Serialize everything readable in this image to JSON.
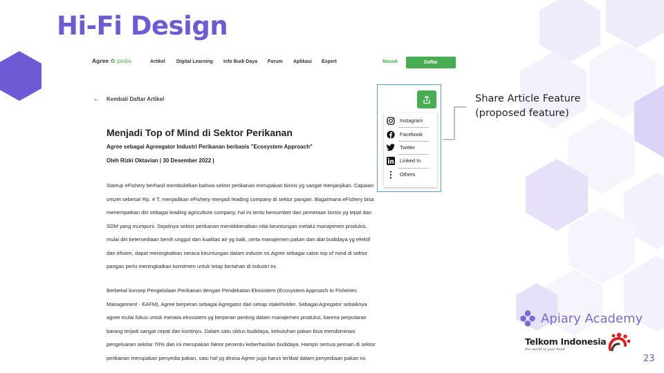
{
  "slide": {
    "title": "Hi-Fi Design",
    "annotation": [
      "Share Article Feature",
      "(proposed feature)"
    ],
    "brand": "Apiary Academy",
    "partner": {
      "name": "Telkom Indonesia",
      "tagline": "the world in your hand"
    },
    "page_number": "23",
    "colors": {
      "accent": "#6c5bd4",
      "hexagon_light": "#ece9fb",
      "hexagon_mid": "#d8d0f6"
    }
  },
  "site": {
    "logo": {
      "part1": "Agree",
      "part2": "pedia",
      "icon": "leaf-icon"
    },
    "nav": [
      "Artikel",
      "Digital Learning",
      "Info Budi Daya",
      "Forum",
      "Aplikasi",
      "Expert"
    ],
    "login": "Masuk",
    "register": "Daftar",
    "accent": "#48ad52"
  },
  "article": {
    "back_label": "Kembali Daftar Artikel",
    "title": "Menjadi Top of Mind di Sektor Perikanan",
    "subtitle": "Agree sebagai Agreegator Industri Perikanan berbasis \"Ecosystem Approach\"",
    "byline": "Oleh Rizki Oktavian | 30 Desember 2022 |",
    "para1": [
      "Startup eFishery berhasil membuktikan bahwa sektor perikanan merupakan bisnis yg sangat menjanjikan. Capaian",
      "omzet sebesar Rp. 4 T, menjadikan eFishery menjadi leading company di sektor pangan. Bagaimana eFishery bisa",
      "menempatkan diri sebagai leading agriculture company, hal ini tentu bersumber dari pemetaan bisnis yg tepat dan",
      "SDM yang mumpuni. Sejatinya sektor perikanan menitikberatkan nilai keuntungan melalui manajemen produksi,",
      "mulai diri ketersediaan benih unggul dan kualitas air yg baik, serta manajemen pakan dan alat budidaya yg efektif",
      "dan efisien, dapat meningkatkan neraca keuntungan dalam industri ini.Agree sebagai calon top of mind di sektor",
      "pangan perlu meningkatkan komitmen untuk tetap bertahan di industri ini."
    ],
    "para2": [
      "Berbekal konsep Pengelolaan Perikanan dengan Pendekatan Ekosistem (Ecosystem Approach to Fisheries",
      "Management - EAFM), Agree berperan sebagai Agregator dari setiap stakeholder. Sebagai Agregator sebaiknya",
      "agree mulai fokus untuk menata ekosistem yg berperan penting dalam manajemen produksi, karena perputaran",
      "barang terjadi sangat cepat dan kontinyu. Dalam satu siklus budidaya, kebutuhan pakan bisa mendominasi",
      "pengeluaran sekitar 70% dan ini merupakan faktor penentu keberhasilan budidaya. Hampir semua pemain di sektor",
      "perikanan merupakan penyedia pakan, satu hal yg dirasa Agree juga harus terlibat dalam penyediaan pakan ini."
    ]
  },
  "share_menu": [
    {
      "label": "Instagram",
      "icon": "instagram-icon"
    },
    {
      "label": "Facebook",
      "icon": "facebook-icon"
    },
    {
      "label": "Twitter",
      "icon": "twitter-icon"
    },
    {
      "label": "Linked In",
      "icon": "linkedin-icon"
    },
    {
      "label": "Others",
      "icon": "more-vertical-icon"
    }
  ]
}
